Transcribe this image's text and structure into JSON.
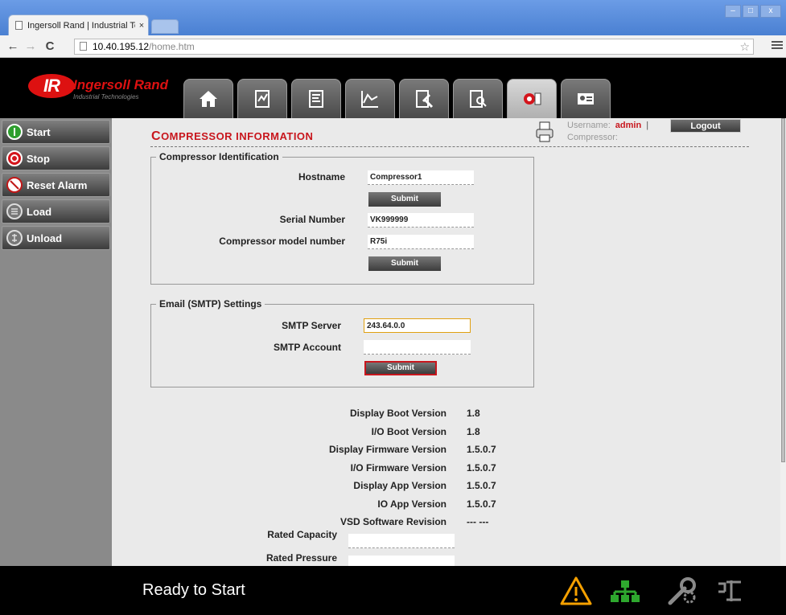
{
  "browser": {
    "tab_title": "Ingersoll Rand | Industrial Tc",
    "tab_close": "×",
    "url_host": "10.40.195.12",
    "url_path": "/home.htm",
    "window_min": "–",
    "window_max": "□",
    "window_close": "x"
  },
  "header": {
    "logo_mark": "IR",
    "logo_brand": "Ingersoll Rand",
    "logo_sub": "Industrial Technologies",
    "tabs": [
      {
        "icon": "home-icon"
      },
      {
        "icon": "status-icon"
      },
      {
        "icon": "settings-icon"
      },
      {
        "icon": "chart-icon"
      },
      {
        "icon": "maintenance-icon"
      },
      {
        "icon": "event-log-icon"
      },
      {
        "icon": "compressor-info-icon"
      },
      {
        "icon": "user-card-icon"
      }
    ]
  },
  "sidebar": {
    "items": [
      {
        "label": "Start",
        "color": "#2e9e2e"
      },
      {
        "label": "Stop",
        "color": "#d4151c"
      },
      {
        "label": "Reset Alarm",
        "color": "#c01818"
      },
      {
        "label": "Load",
        "color": "#7a7a7a"
      },
      {
        "label": "Unload",
        "color": "#7a7a7a"
      }
    ]
  },
  "page": {
    "title_first": "C",
    "title_rest": "OMPRESSOR INFORMATION",
    "username_label": "Username:",
    "username": "admin",
    "separator": "|",
    "compressor_label": "Compressor:",
    "logout_label": "Logout"
  },
  "identification": {
    "legend": "Compressor Identification",
    "hostname_label": "Hostname",
    "hostname_value": "Compressor1",
    "submit1": "Submit",
    "serial_label": "Serial Number",
    "serial_value": "VK999999",
    "model_label": "Compressor model number",
    "model_value": "R75i",
    "submit2": "Submit"
  },
  "smtp": {
    "legend": "Email (SMTP) Settings",
    "server_label": "SMTP Server",
    "server_value": "243.64.0.0",
    "account_label": "SMTP Account",
    "account_value": "",
    "submit": "Submit"
  },
  "versions": [
    {
      "label": "Display Boot Version",
      "value": "1.8"
    },
    {
      "label": "I/O Boot Version",
      "value": "1.8"
    },
    {
      "label": "Display Firmware Version",
      "value": "1.5.0.7"
    },
    {
      "label": "I/O Firmware Version",
      "value": "1.5.0.7"
    },
    {
      "label": "Display App Version",
      "value": "1.5.0.7"
    },
    {
      "label": "IO App Version",
      "value": "1.5.0.7"
    },
    {
      "label": "VSD Software Revision",
      "value": "--- ---"
    }
  ],
  "rated": {
    "capacity_label": "Rated Capacity",
    "capacity_value": "",
    "pressure_label": "Rated Pressure",
    "pressure_value": ""
  },
  "status": {
    "text": "Ready to Start",
    "icons": [
      "warning-icon",
      "network-icon",
      "service-icon",
      "unload-status-icon"
    ],
    "warning_color": "#f5a000",
    "network_color": "#2ea82e"
  }
}
